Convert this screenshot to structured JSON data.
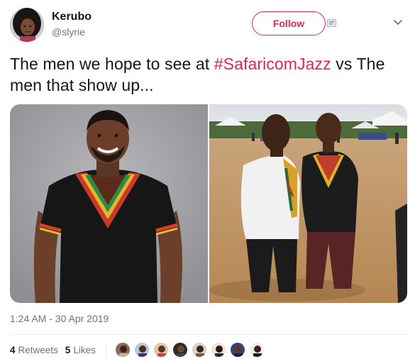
{
  "user": {
    "display_name": "Kerubo",
    "handle": "@slyrie"
  },
  "actions": {
    "follow_label": "Follow"
  },
  "tweet": {
    "text_before": "The men we hope to see at ",
    "hashtag": "#SafaricomJazz",
    "text_after": " vs The men that show up..."
  },
  "timestamp": "1:24 AM - 30 Apr 2019",
  "stats": {
    "retweets_count": "4",
    "retweets_label": "Retweets",
    "likes_count": "5",
    "likes_label": "Likes"
  },
  "colors": {
    "accent": "#e0245e",
    "secondary_text": "#657786",
    "primary_text": "#14171a",
    "divider": "#e6ecf0"
  },
  "icons": [
    "chevron-down-icon",
    "badge-icon"
  ]
}
